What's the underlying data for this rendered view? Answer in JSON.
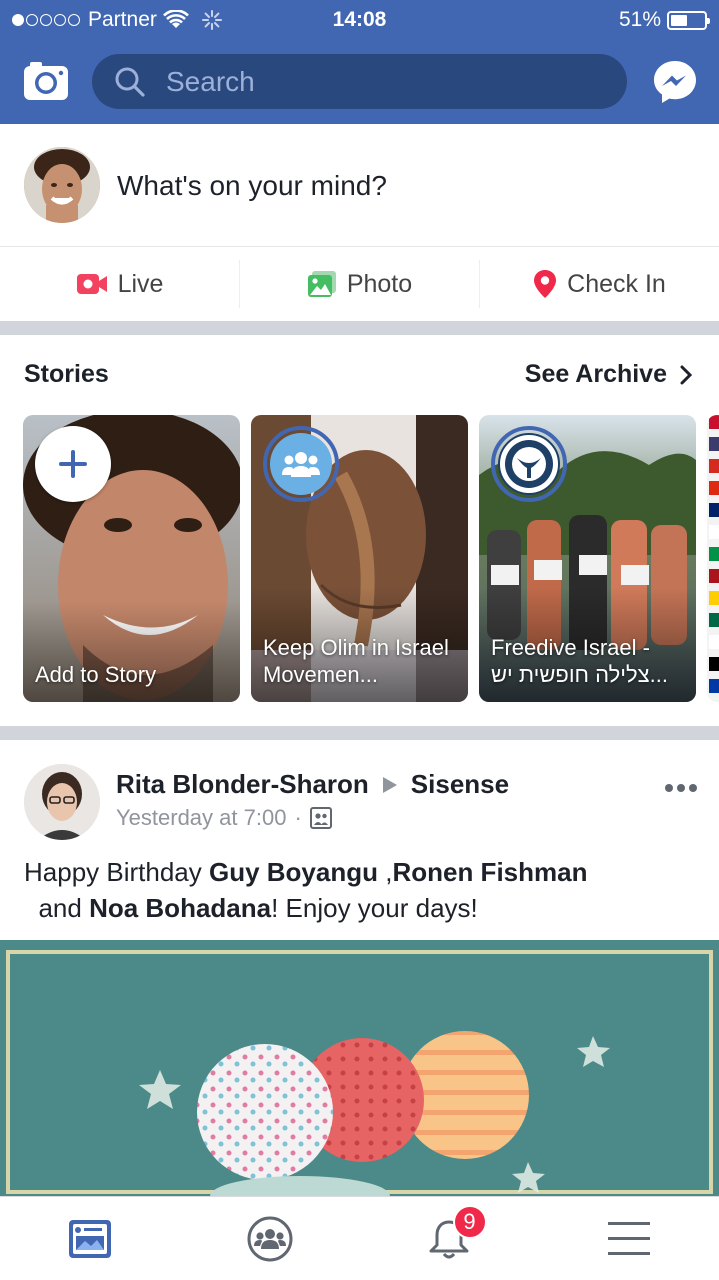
{
  "status_bar": {
    "carrier": "Partner",
    "time": "14:08",
    "battery": "51%",
    "battery_level": 0.51
  },
  "header": {
    "search_placeholder": "Search",
    "left_icon": "camera-icon",
    "right_icon": "messenger-icon"
  },
  "composer": {
    "prompt": "What's on your mind?"
  },
  "actions": [
    {
      "label": "Live",
      "icon": "live-video-icon",
      "color": "#f3425f"
    },
    {
      "label": "Photo",
      "icon": "photo-icon",
      "color": "#45bd62"
    },
    {
      "label": "Check In",
      "icon": "location-pin-icon",
      "color": "#f5533d"
    }
  ],
  "stories": {
    "title": "Stories",
    "archive_label": "See Archive",
    "items": [
      {
        "label": "Add to Story"
      },
      {
        "label": "Keep Olim in Israel Movemen..."
      },
      {
        "label": "Freedive Israel - צלילה חופשית יש..."
      }
    ]
  },
  "post": {
    "author": "Rita Blonder-Sharon",
    "target": "Sisense",
    "time": "Yesterday at 7:00",
    "separator": "·",
    "text_prefix": "Happy Birthday ",
    "name1": "Guy Boyangu",
    "text_comma": " ,",
    "name2": "Ronen Fishman",
    "text_and": " and ",
    "name3": "Noa Bohadana",
    "text_suffix": "! Enjoy your days!"
  },
  "tabbar": {
    "tabs": [
      "news-feed-icon",
      "groups-icon",
      "notifications-icon",
      "menu-icon"
    ],
    "notification_count": "9"
  },
  "colors": {
    "brand": "#4267b2",
    "search_bg": "#29487d",
    "badge": "#f02849"
  }
}
